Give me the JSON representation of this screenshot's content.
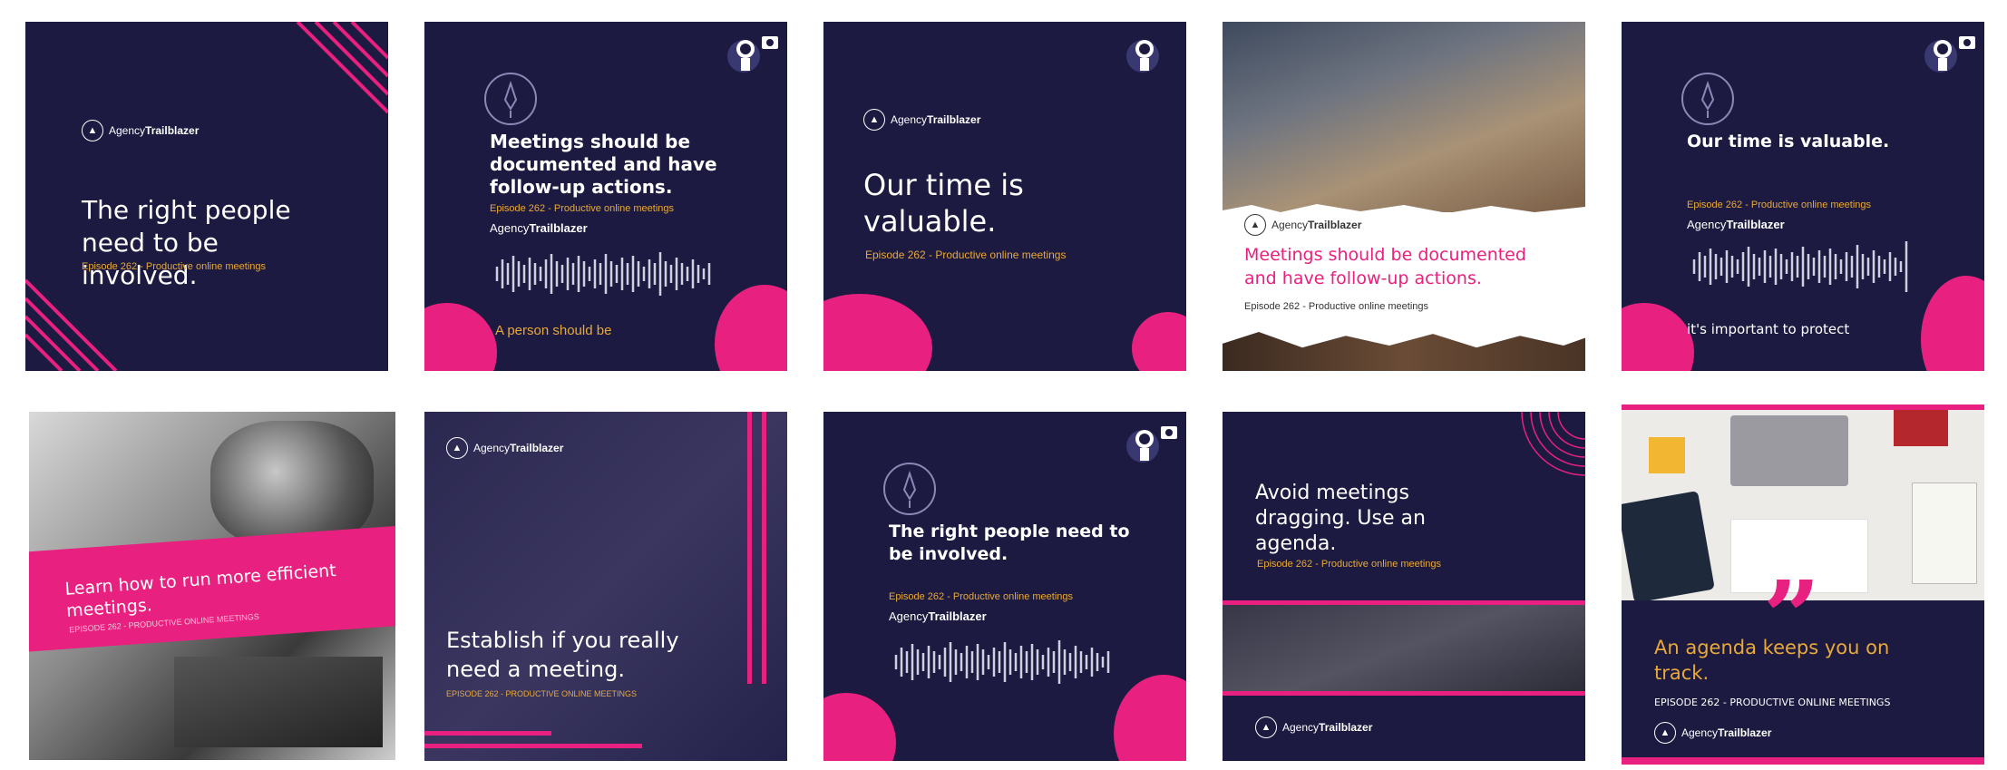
{
  "brand": {
    "prefix": "Agency",
    "name": "Trailblazer"
  },
  "episode": "Episode 262 - Productive online meetings",
  "episode_caps": "EPISODE 262 - PRODUCTIVE ONLINE MEETINGS",
  "tiles": {
    "t1": {
      "quote": "The right people need to be involved."
    },
    "t2": {
      "quote": "Meetings should be documented and have follow-up actions.",
      "caption": "A person should be"
    },
    "t3": {
      "quote": "Our time is valuable."
    },
    "t4": {
      "quote": "Meetings should be documented and have follow-up actions."
    },
    "t5": {
      "quote": "Our time is valuable.",
      "caption": "it's important to protect"
    },
    "t6": {
      "quote": "Learn how to run more efficient meetings."
    },
    "t7": {
      "quote": "Establish if you really need a meeting."
    },
    "t8": {
      "quote": "The right people need to be involved."
    },
    "t9": {
      "quote": "Avoid meetings dragging. Use an agenda."
    },
    "t10": {
      "quote": "An agenda keeps you on track.",
      "quote_mark": "”"
    }
  },
  "colors": {
    "navy": "#1c1a40",
    "pink": "#e8207f",
    "gold": "#e8a93a"
  }
}
